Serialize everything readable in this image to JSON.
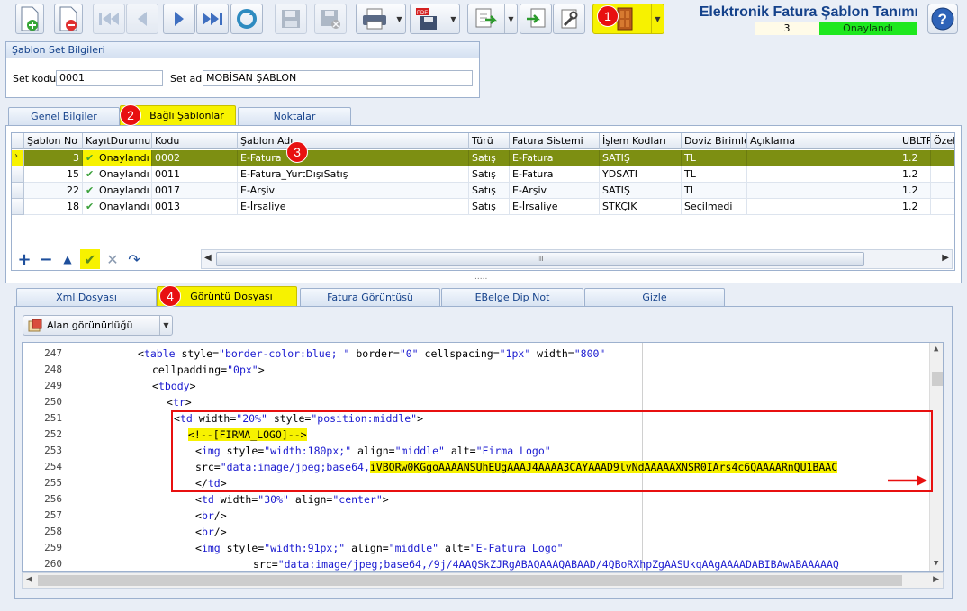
{
  "header": {
    "title": "Elektronik Fatura Şablon Tanımı",
    "record_count": "3",
    "status": "Onaylandı",
    "status_color": "#1ee81e"
  },
  "toolbar": {
    "icons": [
      "new-document-icon",
      "delete-document-icon",
      "first-record-icon",
      "previous-record-icon",
      "next-record-icon",
      "last-record-icon",
      "refresh-icon",
      "save-icon",
      "save-close-icon",
      "print-icon",
      "pdf-save-icon",
      "export-icon",
      "import-icon",
      "tools-icon",
      "exit-door-icon",
      "help-icon"
    ]
  },
  "badges": [
    "1",
    "2",
    "3",
    "4"
  ],
  "set_info": {
    "group_title": "Şablon Set Bilgileri",
    "code_label": "Set kodu",
    "code_value": "0001",
    "name_label": "Set adı",
    "name_value": "MOBİSAN ŞABLON"
  },
  "top_tabs": [
    "Genel Bilgiler",
    "Bağlı Şablonlar",
    "Noktalar"
  ],
  "grid": {
    "columns": [
      "Şablon No",
      "KayıtDurumu",
      "Kodu",
      "Şablon Adı",
      "Türü",
      "Fatura Sistemi",
      "İşlem Kodları",
      "Doviz Birimleri",
      "Açıklama",
      "UBLTR",
      "Özel K"
    ],
    "rows": [
      {
        "no": "3",
        "status": "Onaylandı",
        "code": "0002",
        "name": "E-Fatura",
        "type": "Satış",
        "system": "E-Fatura",
        "op": "SATIŞ",
        "currency": "TL",
        "desc": "",
        "ubl": "1.2"
      },
      {
        "no": "15",
        "status": "Onaylandı",
        "code": "0011",
        "name": "E-Fatura_YurtDışıSatış",
        "type": "Satış",
        "system": "E-Fatura",
        "op": "YDSATI",
        "currency": "TL",
        "desc": "",
        "ubl": "1.2"
      },
      {
        "no": "22",
        "status": "Onaylandı",
        "code": "0017",
        "name": "E-Arşiv",
        "type": "Satış",
        "system": "E-Arşiv",
        "op": "SATIŞ",
        "currency": "TL",
        "desc": "",
        "ubl": "1.2"
      },
      {
        "no": "18",
        "status": "Onaylandı",
        "code": "0013",
        "name": "E-İrsaliye",
        "type": "Satış",
        "system": "E-İrsaliye",
        "op": "STKÇIK",
        "currency": "Seçilmedi",
        "desc": "",
        "ubl": "1.2"
      }
    ],
    "selected_color": "#7d8f12",
    "scroll_glyph": "III",
    "splitter_glyph": "....."
  },
  "bottom_tabs": [
    "Xml Dosyası",
    "Görüntü Dosyası",
    "Fatura Görüntüsü",
    "EBelge Dip Not",
    "Gizle"
  ],
  "visibility_button": "Alan görünürlüğü",
  "editor": {
    "lines": [
      {
        "n": "247",
        "indent": 80,
        "parts": [
          [
            "k",
            "<"
          ],
          [
            "t",
            "table"
          ],
          [
            "a",
            " style="
          ],
          [
            "v",
            "\"border-color:blue; \""
          ],
          [
            "a",
            " border="
          ],
          [
            "v",
            "\"0\""
          ],
          [
            "a",
            " cellspacing="
          ],
          [
            "v",
            "\"1px\""
          ],
          [
            "a",
            " width="
          ],
          [
            "v",
            "\"800\""
          ]
        ]
      },
      {
        "n": "248",
        "indent": 96,
        "parts": [
          [
            "a",
            "cellpadding="
          ],
          [
            "v",
            "\"0px\""
          ],
          [
            "k",
            ">"
          ]
        ]
      },
      {
        "n": "249",
        "indent": 96,
        "parts": [
          [
            "k",
            "<"
          ],
          [
            "t",
            "tbody"
          ],
          [
            "k",
            ">"
          ]
        ]
      },
      {
        "n": "250",
        "indent": 112,
        "parts": [
          [
            "k",
            "<"
          ],
          [
            "t",
            "tr"
          ],
          [
            "k",
            ">"
          ]
        ]
      },
      {
        "n": "251",
        "indent": 120,
        "parts": [
          [
            "k",
            "<"
          ],
          [
            "t",
            "td"
          ],
          [
            "a",
            " width="
          ],
          [
            "v",
            "\"20%\""
          ],
          [
            "a",
            " style="
          ],
          [
            "v",
            "\"position:middle\""
          ],
          [
            "k",
            ">"
          ]
        ]
      },
      {
        "n": "252",
        "indent": 136,
        "parts": [
          [
            "hl",
            "<!--[FIRMA_LOGO]-->"
          ]
        ]
      },
      {
        "n": "253",
        "indent": 144,
        "parts": [
          [
            "k",
            "<"
          ],
          [
            "t",
            "img"
          ],
          [
            "a",
            " style="
          ],
          [
            "v",
            "\"width:180px;\""
          ],
          [
            "a",
            " align="
          ],
          [
            "v",
            "\"middle\""
          ],
          [
            "a",
            " alt="
          ],
          [
            "v",
            "\"Firma Logo\""
          ]
        ]
      },
      {
        "n": "254",
        "indent": 144,
        "parts": [
          [
            "a",
            "src="
          ],
          [
            "v",
            "\"data:image/jpeg;base64,"
          ],
          [
            "hl",
            "iVBORw0KGgoAAAANSUhEUgAAAJ4AAAA3CAYAAAD9lvNdAAAAAXNSR0IArs4c6QAAAARnQU1BAAC"
          ]
        ]
      },
      {
        "n": "255",
        "indent": 144,
        "parts": [
          [
            "k",
            "</"
          ],
          [
            "t",
            "td"
          ],
          [
            "k",
            ">"
          ]
        ]
      },
      {
        "n": "256",
        "indent": 144,
        "parts": [
          [
            "k",
            "<"
          ],
          [
            "t",
            "td"
          ],
          [
            "a",
            " width="
          ],
          [
            "v",
            "\"30%\""
          ],
          [
            "a",
            " align="
          ],
          [
            "v",
            "\"center\""
          ],
          [
            "k",
            ">"
          ]
        ]
      },
      {
        "n": "257",
        "indent": 144,
        "parts": [
          [
            "k",
            "<"
          ],
          [
            "t",
            "br"
          ],
          [
            "k",
            "/>"
          ]
        ]
      },
      {
        "n": "258",
        "indent": 144,
        "parts": [
          [
            "k",
            "<"
          ],
          [
            "t",
            "br"
          ],
          [
            "k",
            "/>"
          ]
        ]
      },
      {
        "n": "259",
        "indent": 144,
        "parts": [
          [
            "k",
            "<"
          ],
          [
            "t",
            "img"
          ],
          [
            "a",
            " style="
          ],
          [
            "v",
            "\"width:91px;\""
          ],
          [
            "a",
            " align="
          ],
          [
            "v",
            "\"middle\""
          ],
          [
            "a",
            " alt="
          ],
          [
            "v",
            "\"E-Fatura Logo\""
          ]
        ]
      },
      {
        "n": "260",
        "indent": 208,
        "parts": [
          [
            "a",
            "src="
          ],
          [
            "v",
            "\"data:image/jpeg;base64,/9j/4AAQSkZJRgABAQAAAQABAAD/4QBoRXhpZgAASUkqAAgAAAADABIBAwABAAAAAQ"
          ]
        ]
      }
    ],
    "highlight_color": "#e81010"
  }
}
